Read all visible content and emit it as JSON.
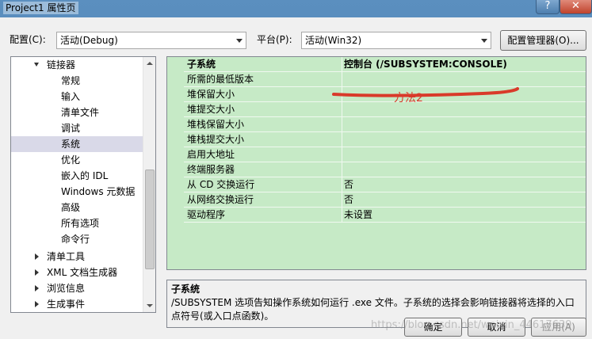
{
  "window": {
    "title": "Project1 属性页",
    "help_glyph": "?",
    "close_glyph": "✕"
  },
  "config": {
    "label": "配置(C):",
    "value": "活动(Debug)"
  },
  "platform": {
    "label": "平台(P):",
    "value": "活动(Win32)"
  },
  "config_manager_label": "配置管理器(O)...",
  "tree": {
    "items": [
      {
        "label": "链接器",
        "expanded": true
      },
      {
        "label": "常规"
      },
      {
        "label": "输入"
      },
      {
        "label": "清单文件"
      },
      {
        "label": "调试"
      },
      {
        "label": "系统",
        "selected": true
      },
      {
        "label": "优化"
      },
      {
        "label": "嵌入的 IDL"
      },
      {
        "label": "Windows 元数据"
      },
      {
        "label": "高级"
      },
      {
        "label": "所有选项"
      },
      {
        "label": "命令行"
      },
      {
        "label": "清单工具",
        "expanded": false
      },
      {
        "label": "XML 文档生成器",
        "expanded": false
      },
      {
        "label": "浏览信息",
        "expanded": false
      },
      {
        "label": "生成事件",
        "expanded": false
      }
    ]
  },
  "grid": {
    "rows": [
      {
        "name": "子系统",
        "value": "控制台 (/SUBSYSTEM:CONSOLE)"
      },
      {
        "name": "所需的最低版本",
        "value": ""
      },
      {
        "name": "堆保留大小",
        "value": ""
      },
      {
        "name": "堆提交大小",
        "value": ""
      },
      {
        "name": "堆栈保留大小",
        "value": ""
      },
      {
        "name": "堆栈提交大小",
        "value": ""
      },
      {
        "name": "启用大地址",
        "value": ""
      },
      {
        "name": "终端服务器",
        "value": ""
      },
      {
        "name": "从 CD 交换运行",
        "value": "否"
      },
      {
        "name": "从网络交换运行",
        "value": "否"
      },
      {
        "name": "驱动程序",
        "value": "未设置"
      }
    ]
  },
  "annotation": "方法2",
  "description": {
    "title": "子系统",
    "text": "/SUBSYSTEM 选项告知操作系统如何运行 .exe 文件。子系统的选择会影响链接器将选择的入口点符号(或入口点函数)。"
  },
  "buttons": {
    "ok": "确定",
    "cancel": "取消",
    "apply": "应用(A)"
  },
  "watermark": "https://blog.csdn.net/weixin_44617639",
  "colors": {
    "grid_bg": "#c6eac6",
    "annotation_red": "#d93a2a",
    "selection": "#d9d9e8"
  }
}
